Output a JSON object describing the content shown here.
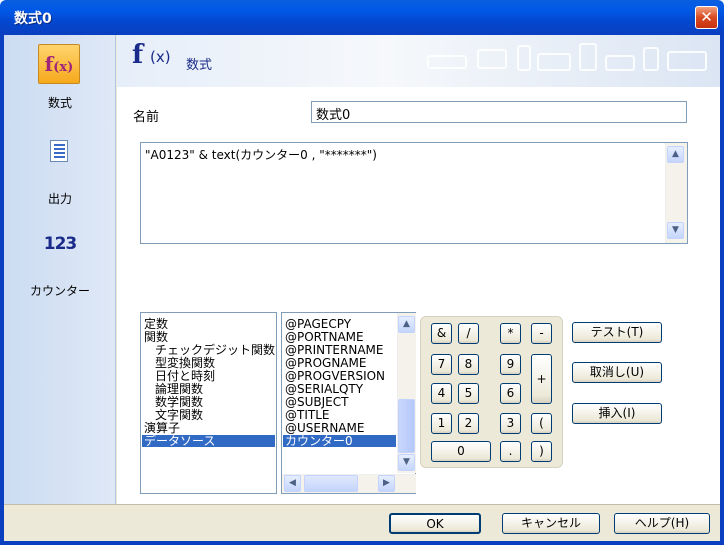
{
  "window": {
    "title": "数式0",
    "close_glyph": "✕"
  },
  "sidebar": {
    "items": [
      {
        "label": "数式",
        "icon": "formula-icon",
        "icon_text": "f(x)"
      },
      {
        "label": "出力",
        "icon": "output-document-icon"
      },
      {
        "label": "カウンター",
        "icon": "counter-icon",
        "icon_text": "123"
      }
    ]
  },
  "header": {
    "f": "f",
    "x": "(x)",
    "title": "数式"
  },
  "name": {
    "label": "名前",
    "value": "数式0"
  },
  "formula": {
    "text": "\"A0123\" & text(カウンター0 , \"*******\")"
  },
  "categories": {
    "items": [
      {
        "label": "定数",
        "indent": 0
      },
      {
        "label": "関数",
        "indent": 0
      },
      {
        "label": "チェックデジット関数",
        "indent": 1
      },
      {
        "label": "型変換関数",
        "indent": 1
      },
      {
        "label": "日付と時刻",
        "indent": 1
      },
      {
        "label": "論理関数",
        "indent": 1
      },
      {
        "label": "数学関数",
        "indent": 1
      },
      {
        "label": "文字関数",
        "indent": 1
      },
      {
        "label": "演算子",
        "indent": 0
      },
      {
        "label": "データソース",
        "indent": 0,
        "selected": true
      }
    ]
  },
  "fields": {
    "items": [
      {
        "label": "@PAGECPY"
      },
      {
        "label": "@PORTNAME"
      },
      {
        "label": "@PRINTERNAME"
      },
      {
        "label": "@PROGNAME"
      },
      {
        "label": "@PROGVERSION"
      },
      {
        "label": "@SERIALQTY"
      },
      {
        "label": "@SUBJECT"
      },
      {
        "label": "@TITLE"
      },
      {
        "label": "@USERNAME"
      },
      {
        "label": "カウンター0",
        "selected": true
      }
    ]
  },
  "keypad": {
    "amp": "&",
    "slash": "/",
    "star": "*",
    "minus": "-",
    "k7": "7",
    "k8": "8",
    "k9": "9",
    "plus": "+",
    "k4": "4",
    "k5": "5",
    "k6": "6",
    "k1": "1",
    "k2": "2",
    "k3": "3",
    "lparen": "(",
    "k0": "0",
    "dot": ".",
    "rparen": ")"
  },
  "actions": {
    "test": "テスト(T)",
    "undo": "取消し(U)",
    "insert": "挿入(I)"
  },
  "footer": {
    "ok": "OK",
    "cancel": "キャンセル",
    "help": "ヘルプ(H)"
  },
  "colors": {
    "titlebar": "#0058e6",
    "selection": "#316ac5",
    "sidebar": "#d6e2f4",
    "accent_orange": "#f6a91c"
  }
}
